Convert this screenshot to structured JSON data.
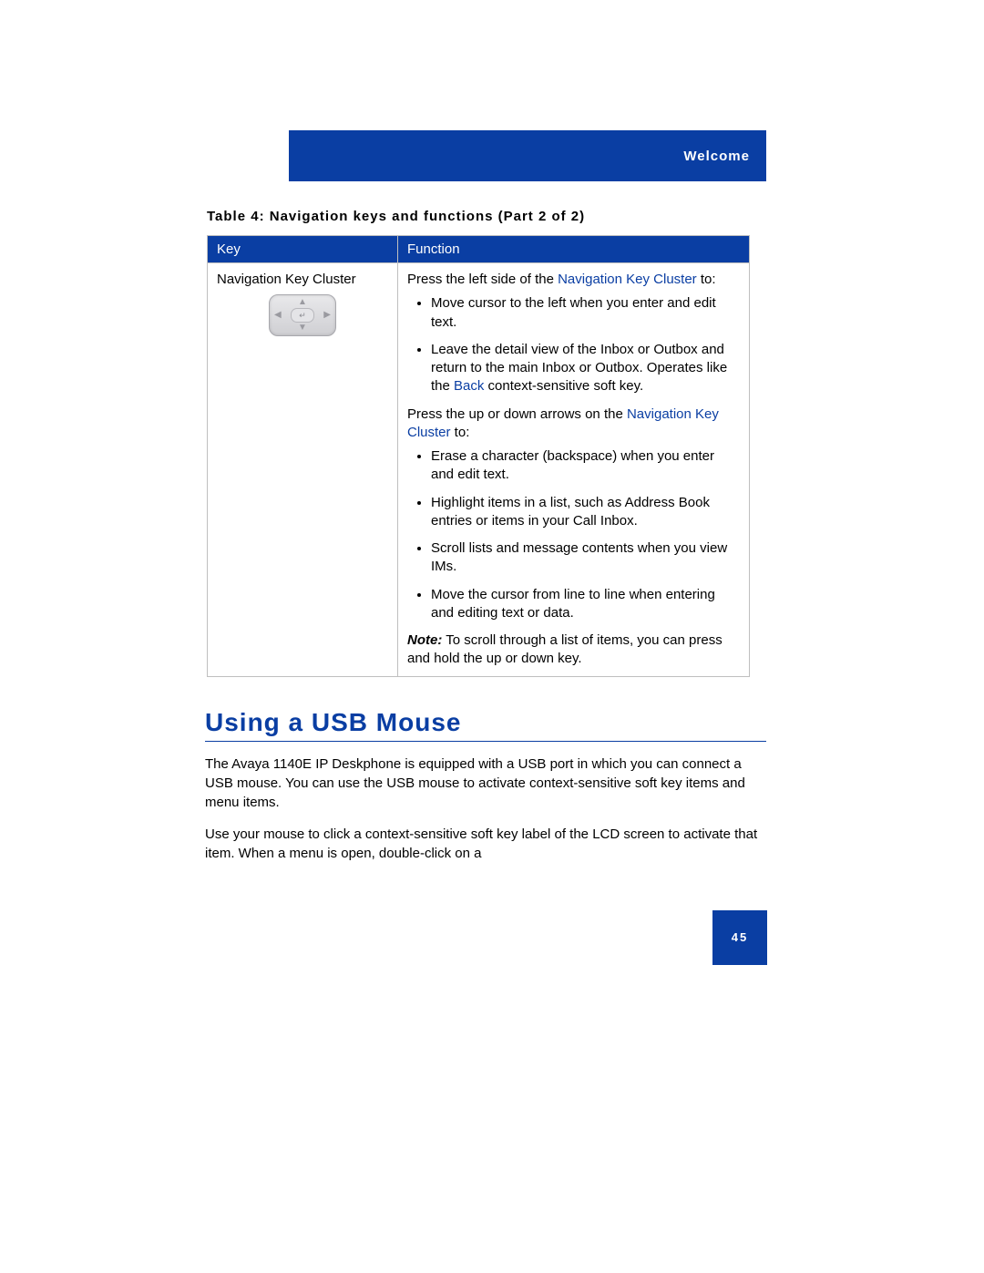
{
  "header": {
    "section": "Welcome"
  },
  "table": {
    "caption": "Table 4: Navigation keys and functions (Part 2 of 2)",
    "head": {
      "key": "Key",
      "function": "Function"
    },
    "row": {
      "keyName": "Navigation Key Cluster",
      "pressLeftPrefix": "Press the left side of the ",
      "navClusterLink1": "Navigation Key Cluster",
      "toSuffix1": " to:",
      "leftBullets": [
        "Move cursor to the left when you enter and edit text.",
        "Leave the detail view of the Inbox or Outbox and return to the main Inbox or Outbox. Operates like the "
      ],
      "backLink": "Back",
      "backTail": " context-sensitive soft key.",
      "pressUpDownPrefix": "Press the up or down arrows on the ",
      "navClusterLink2": "Navigation Key Cluster",
      "toSuffix2": " to:",
      "upDownBullets": [
        "Erase a character (backspace) when you enter and edit text.",
        "Highlight items in a list, such as Address Book entries or items in your Call Inbox.",
        "Scroll lists and message contents when you view IMs.",
        "Move the cursor from line to line when entering and editing text or data."
      ],
      "noteLabel": "Note:",
      "noteText": "  To scroll through a list of items, you can press and hold the up or down key."
    }
  },
  "section": {
    "title": "Using a USB Mouse",
    "p1": "The Avaya 1140E IP Deskphone is equipped with a USB port in which you can connect a USB mouse. You can use the USB mouse to activate context-sensitive soft key items and menu items.",
    "p2": "Use your mouse to click a context-sensitive soft key label of the LCD screen to activate that item. When a menu is open, double-click on a"
  },
  "footer": {
    "pageNumber": "45"
  }
}
